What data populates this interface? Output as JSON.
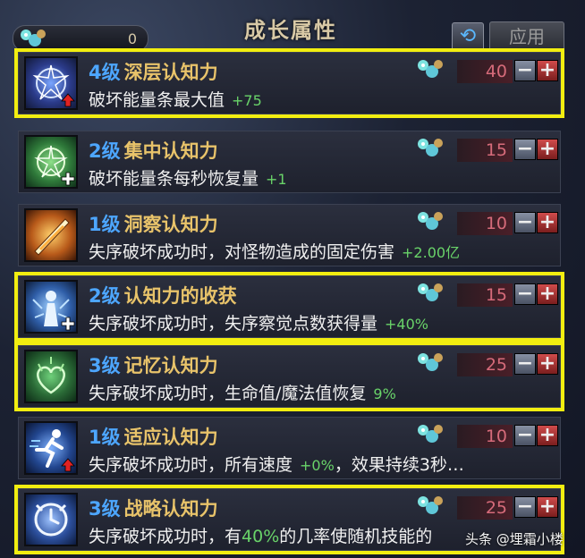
{
  "header": {
    "title": "成长属性",
    "currency_count": "0",
    "apply_label": "应用"
  },
  "skills": [
    {
      "level": "4级",
      "name": "深层认知力",
      "desc": "破坏能量条最大值",
      "bonus": "+75",
      "cost": "40",
      "icon": "shatter-sphere-icon",
      "badge": "up-arrow"
    },
    {
      "level": "2级",
      "name": "集中认知力",
      "desc": "破坏能量条每秒恢复量",
      "bonus": "+1",
      "cost": "15",
      "icon": "green-sphere-icon",
      "badge": "plus"
    },
    {
      "level": "1级",
      "name": "洞察认知力",
      "desc": "失序破坏成功时，对怪物造成的固定伤害",
      "bonus": "+2.00亿",
      "cost": "10",
      "icon": "fire-slash-icon",
      "badge": ""
    },
    {
      "level": "2级",
      "name": "认知力的收获",
      "desc": "失序破坏成功时，失序察觉点数获得量",
      "bonus": "+40%",
      "cost": "15",
      "icon": "blue-figure-icon",
      "badge": "plus"
    },
    {
      "level": "3级",
      "name": "记忆认知力",
      "desc": "失序破坏成功时，生命值/魔法值恢复",
      "bonus": "9%",
      "cost": "25",
      "icon": "green-heart-icon",
      "badge": ""
    },
    {
      "level": "1级",
      "name": "适应认知力",
      "desc": "失序破坏成功时，所有速度",
      "bonus": "+0%",
      "desc_tail": "，效果持续3秒…",
      "cost": "10",
      "icon": "runner-icon",
      "badge": "up-arrow"
    },
    {
      "level": "3级",
      "name": "战略认知力",
      "desc": "失序破坏成功时，有",
      "bonus": "40%",
      "desc_tail": "的几率使随机技能的",
      "cost": "25",
      "icon": "clock-icon",
      "badge": ""
    }
  ],
  "highlighted_rows": [
    0,
    3,
    4,
    6
  ],
  "watermark": "头条 @埋霜小楼",
  "colors": {
    "level": "#4da6ff",
    "name": "#e8c36a",
    "bonus": "#69d369",
    "cost": "#d66b7a",
    "highlight": "#f2ee10"
  }
}
